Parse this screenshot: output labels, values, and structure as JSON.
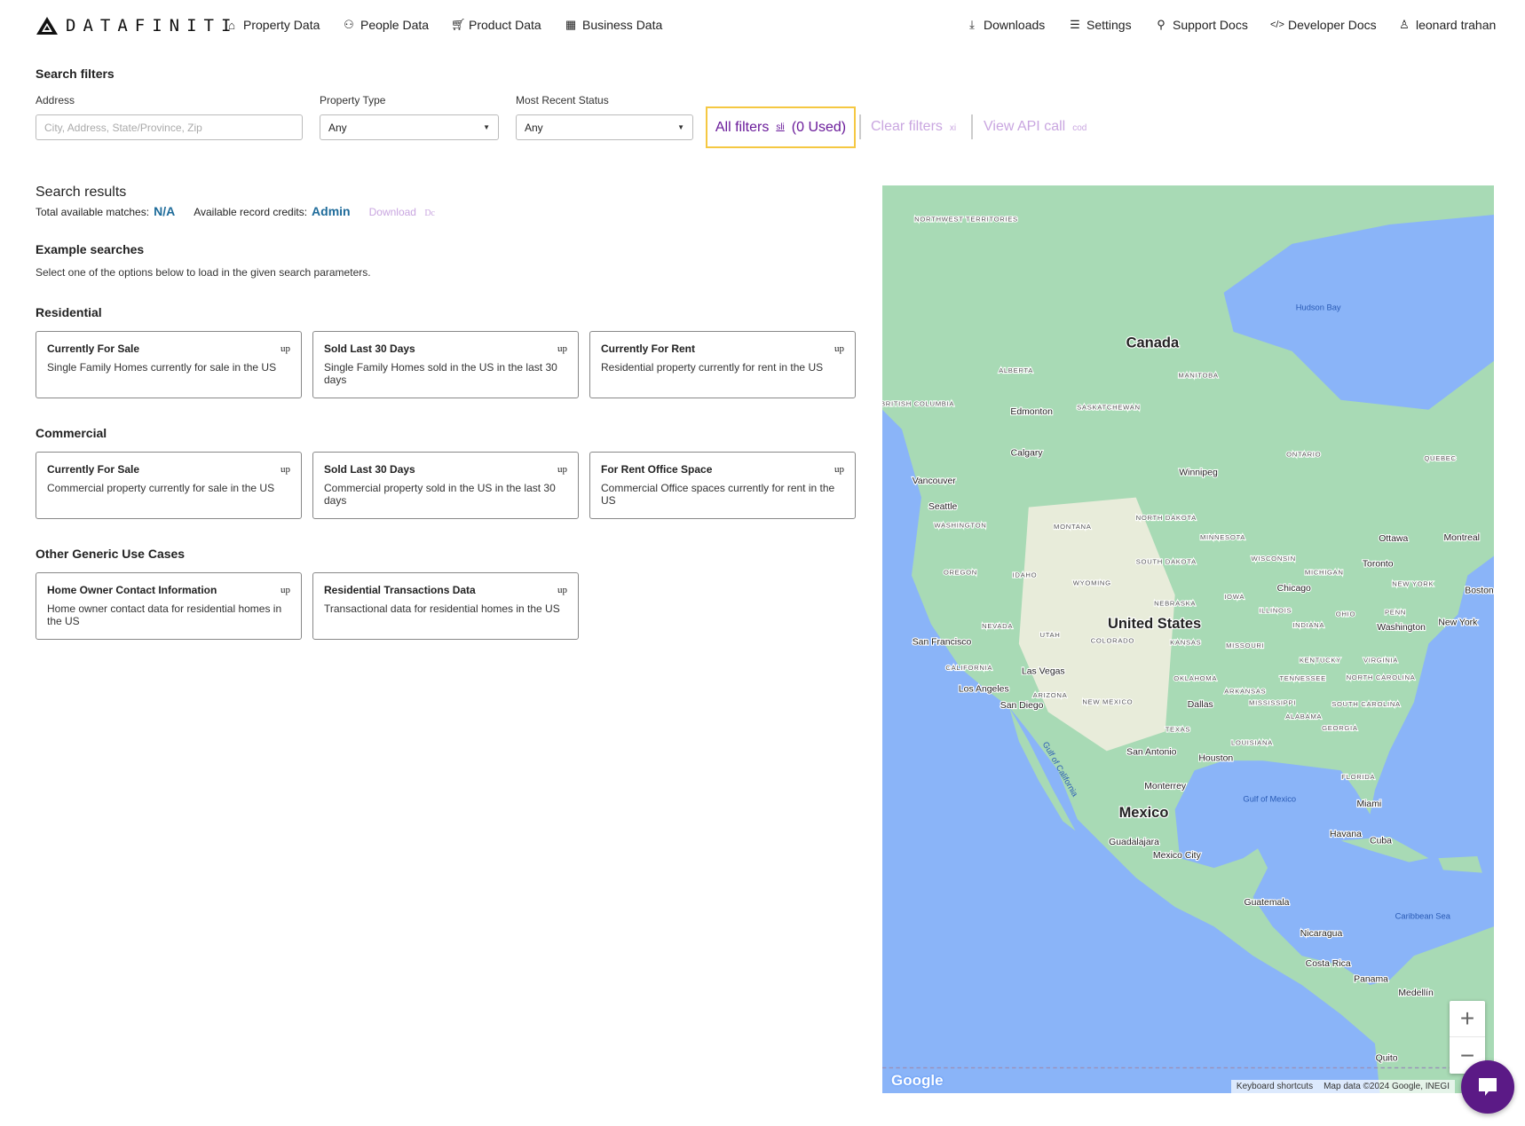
{
  "nav": {
    "logo": "DATAFINITI",
    "left": [
      {
        "label": "Property Data",
        "icon": "home-icon"
      },
      {
        "label": "People Data",
        "icon": "people-icon"
      },
      {
        "label": "Product Data",
        "icon": "cart-icon"
      },
      {
        "label": "Business Data",
        "icon": "building-icon"
      }
    ],
    "right": [
      {
        "label": "Downloads",
        "icon": "download-icon"
      },
      {
        "label": "Settings",
        "icon": "sliders-icon"
      },
      {
        "label": "Support Docs",
        "icon": "location-pin-icon"
      },
      {
        "label": "Developer Docs",
        "icon": "code-icon"
      },
      {
        "label": "leonard trahan",
        "icon": "user-icon"
      }
    ]
  },
  "filters": {
    "title": "Search filters",
    "address": {
      "label": "Address",
      "placeholder": "City, Address, State/Province, Zip",
      "value": ""
    },
    "property_type": {
      "label": "Property Type",
      "value": "Any"
    },
    "status": {
      "label": "Most Recent Status",
      "value": "Any"
    },
    "all_filters": {
      "label": "All filters",
      "icon_text": "sli",
      "count": "(0 Used)"
    },
    "clear_filters": {
      "label": "Clear filters",
      "icon_text": "xi"
    },
    "view_api": {
      "label": "View API call",
      "icon_text": "cod"
    }
  },
  "results": {
    "title": "Search results",
    "matches_label": "Total available matches:",
    "matches_value": "N/A",
    "credits_label": "Available record credits:",
    "credits_value": "Admin",
    "download_label": "Download",
    "download_icon_text": "Dc"
  },
  "examples": {
    "title": "Example searches",
    "subtitle": "Select one of the options below to load in the given search parameters.",
    "groups": [
      {
        "title": "Residential",
        "cards": [
          {
            "title": "Currently For Sale",
            "desc": "Single Family Homes currently for sale in the US",
            "icon": "up"
          },
          {
            "title": "Sold Last 30 Days",
            "desc": "Single Family Homes sold in the US in the last 30 days",
            "icon": "up"
          },
          {
            "title": "Currently For Rent",
            "desc": "Residential property currently for rent in the US",
            "icon": "up"
          }
        ]
      },
      {
        "title": "Commercial",
        "cards": [
          {
            "title": "Currently For Sale",
            "desc": "Commercial property currently for sale in the US",
            "icon": "up"
          },
          {
            "title": "Sold Last 30 Days",
            "desc": "Commercial property sold in the US in the last 30 days",
            "icon": "up"
          },
          {
            "title": "For Rent Office Space",
            "desc": "Commercial Office spaces currently for rent in the US",
            "icon": "up"
          }
        ]
      },
      {
        "title": "Other Generic Use Cases",
        "cards": [
          {
            "title": "Home Owner Contact Information",
            "desc": "Home owner contact data for residential homes in the US",
            "icon": "up"
          },
          {
            "title": "Residential Transactions Data",
            "desc": "Transactional data for residential homes in the US",
            "icon": "up"
          }
        ]
      }
    ]
  },
  "map": {
    "labels": [
      "Canada",
      "United States",
      "Mexico",
      "Hudson Bay",
      "Gulf of Mexico",
      "Caribbean Sea",
      "NORTHWEST TERRITORIES",
      "ALBERTA",
      "MANITOBA",
      "SASKATCHEWAN",
      "BRITISH COLUMBIA",
      "ONTARIO",
      "QUEBEC",
      "Edmonton",
      "Calgary",
      "Winnipeg",
      "Vancouver",
      "Seattle",
      "WASHINGTON",
      "MONTANA",
      "NORTH DAKOTA",
      "MINNESOTA",
      "SOUTH DAKOTA",
      "WISCONSIN",
      "MICHIGAN",
      "Ottawa",
      "Montreal",
      "Toronto",
      "NEW YORK",
      "Boston",
      "New York",
      "OREGON",
      "IDAHO",
      "WYOMING",
      "NEBRASKA",
      "IOWA",
      "Chicago",
      "ILLINOIS",
      "INDIANA",
      "OHIO",
      "PENN",
      "Washington",
      "NEVADA",
      "UTAH",
      "COLORADO",
      "KANSAS",
      "MISSOURI",
      "KENTUCKY",
      "VIRGINIA",
      "San Francisco",
      "CALIFORNIA",
      "Las Vegas",
      "Los Angeles",
      "ARIZONA",
      "San Diego",
      "NEW MEXICO",
      "OKLAHOMA",
      "ARKANSAS",
      "TENNESSEE",
      "NORTH CAROLINA",
      "MISSISSIPPI",
      "ALABAMA",
      "SOUTH CAROLINA",
      "GEORGIA",
      "Dallas",
      "TEXAS",
      "LOUISIANA",
      "San Antonio",
      "Houston",
      "FLORIDA",
      "Miami",
      "Monterrey",
      "Guadalajara",
      "Mexico City",
      "Havana",
      "Cuba",
      "Guatemala",
      "Nicaragua",
      "Costa Rica",
      "Panama",
      "Medellín",
      "Quito",
      "Gulf of California"
    ],
    "zoom_in": "+",
    "zoom_out": "−",
    "google": "Google",
    "keyboard_shortcuts": "Keyboard shortcuts",
    "map_data": "Map data ©2024 Google, INEGI",
    "colors": {
      "water": "#8ab4f8",
      "land": "#a8dab5",
      "desert": "#f3efe0"
    }
  }
}
